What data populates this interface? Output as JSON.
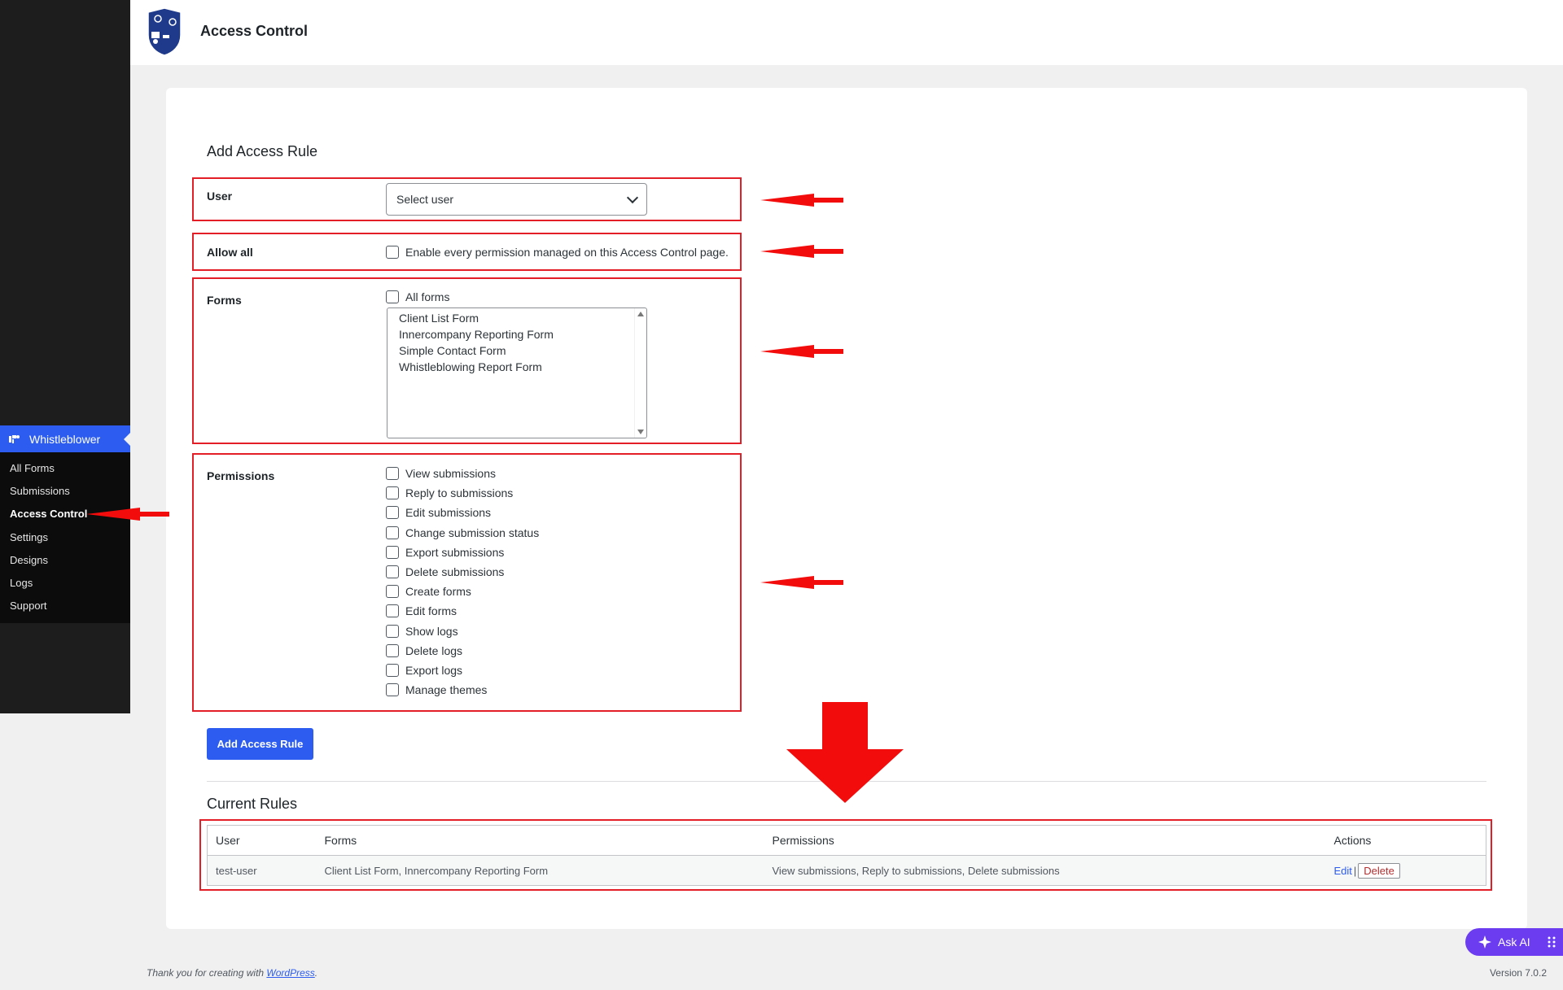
{
  "sidebar": {
    "menu_title": "Whistleblower",
    "items": [
      {
        "label": "All Forms"
      },
      {
        "label": "Submissions"
      },
      {
        "label": "Access Control"
      },
      {
        "label": "Settings"
      },
      {
        "label": "Designs"
      },
      {
        "label": "Logs"
      },
      {
        "label": "Support"
      }
    ]
  },
  "header": {
    "title": "Access Control"
  },
  "add_rule": {
    "title": "Add Access Rule",
    "user_label": "User",
    "user_select_value": "Select user",
    "allow_all_label": "Allow all",
    "allow_all_text": "Enable every permission managed on this Access Control page.",
    "forms_label": "Forms",
    "all_forms_text": "All forms",
    "form_options": [
      "Client List Form",
      "Innercompany Reporting Form",
      "Simple Contact Form",
      "Whistleblowing Report Form"
    ],
    "permissions_label": "Permissions",
    "permissions": [
      "View submissions",
      "Reply to submissions",
      "Edit submissions",
      "Change submission status",
      "Export submissions",
      "Delete submissions",
      "Create forms",
      "Edit forms",
      "Show logs",
      "Delete logs",
      "Export logs",
      "Manage themes"
    ],
    "submit_label": "Add Access Rule"
  },
  "current_rules": {
    "title": "Current Rules",
    "columns": [
      "User",
      "Forms",
      "Permissions",
      "Actions"
    ],
    "rows": [
      {
        "user": "test-user",
        "forms": "Client List Form, Innercompany Reporting Form",
        "permissions": "View submissions, Reply to submissions, Delete submissions",
        "edit_label": "Edit",
        "separator": "|",
        "delete_label": "Delete"
      }
    ]
  },
  "footer": {
    "thanks_prefix": "Thank you for creating with ",
    "thanks_link": "WordPress",
    "thanks_suffix": ".",
    "version": "Version 7.0.2"
  },
  "ask_ai": {
    "label": "Ask AI"
  },
  "colors": {
    "accent": "#2c5cf0",
    "highlight": "#e41e26",
    "ask_ai": "#6b3cf0"
  }
}
